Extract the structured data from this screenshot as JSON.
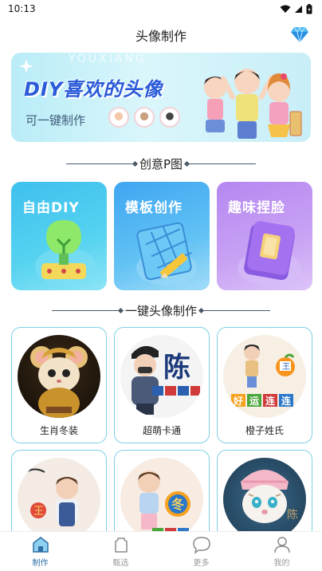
{
  "status": {
    "time": "10:13",
    "icons": [
      "wifi-icon",
      "signal-icon",
      "battery-icon"
    ]
  },
  "header": {
    "title": "头像制作",
    "premium_icon": "diamond-icon"
  },
  "banner": {
    "title": "DIY喜欢的头像",
    "subtitle": "可一键制作",
    "bg_text": "YOUXIANG"
  },
  "section_creative": {
    "title": "创意P图"
  },
  "creative_cards": [
    {
      "label": "自由DIY",
      "icon": "lightbulb-icon",
      "color": "#3ab0e8"
    },
    {
      "label": "模板创作",
      "icon": "template-pencil-icon",
      "color": "#4aa8f0"
    },
    {
      "label": "趣味捏脸",
      "icon": "face-card-icon",
      "color": "#b48af0"
    }
  ],
  "section_oneclick": {
    "title": "一键头像制作"
  },
  "avatars": [
    {
      "label": "生肖冬装",
      "style": "mouse-gold"
    },
    {
      "label": "超萌卡通",
      "style": "cartoon-chen"
    },
    {
      "label": "橙子姓氏",
      "style": "orange-surname"
    },
    {
      "label": "",
      "style": "boy-wang"
    },
    {
      "label": "",
      "style": "girl-dong"
    },
    {
      "label": "",
      "style": "tiger-chen"
    }
  ],
  "avatar_text": {
    "chen": "陈",
    "wang": "王",
    "dong": "冬",
    "orange_tiles": [
      "好",
      "运",
      "连",
      "连"
    ]
  },
  "tabs": [
    {
      "label": "制作",
      "icon": "home-icon",
      "active": true
    },
    {
      "label": "甄选",
      "icon": "bag-icon",
      "active": false
    },
    {
      "label": "更多",
      "icon": "chat-bubble-icon",
      "active": false
    },
    {
      "label": "我的",
      "icon": "user-icon",
      "active": false
    }
  ],
  "colors": {
    "accent": "#2d6ea6",
    "card_border": "#7fd0e6",
    "banner_title": "#2a5ad8"
  }
}
